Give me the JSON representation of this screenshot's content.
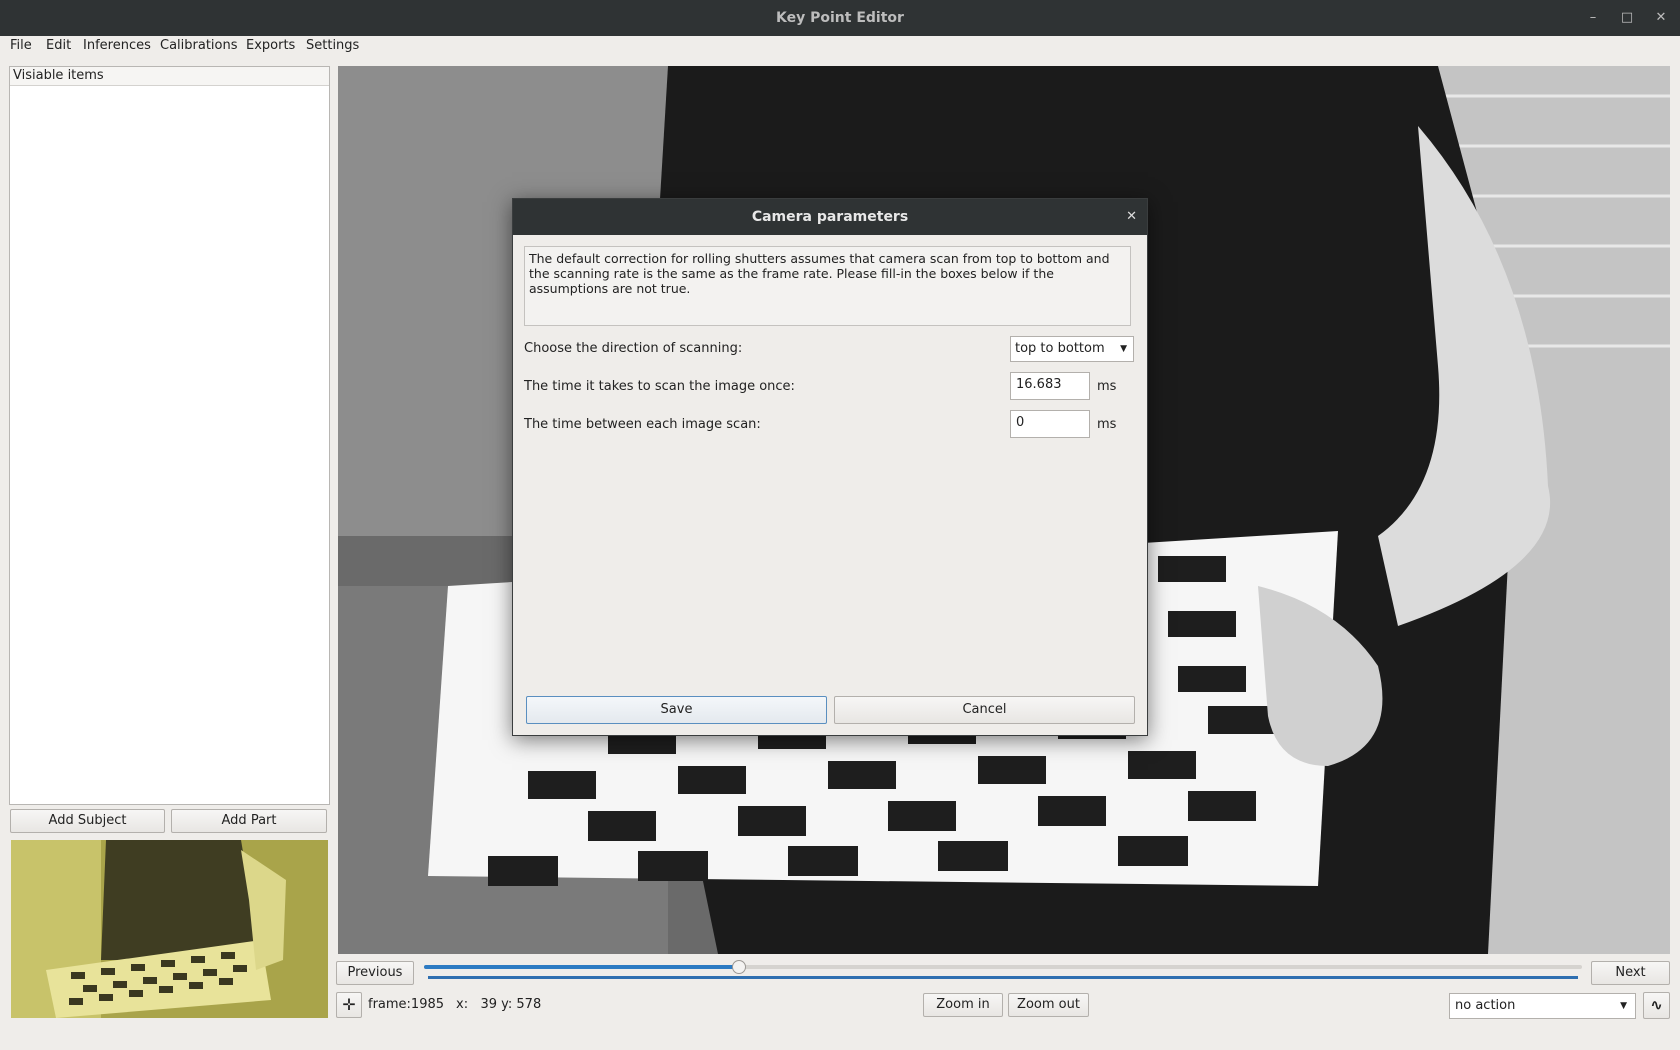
{
  "window": {
    "title": "Key Point Editor"
  },
  "menu": [
    "File",
    "Edit",
    "Inferences",
    "Calibrations",
    "Exports",
    "Settings"
  ],
  "left_panel": {
    "header": "Visiable items",
    "add_subject": "Add Subject",
    "add_part": "Add Part"
  },
  "nav": {
    "previous": "Previous",
    "next": "Next",
    "progress_fraction": 0.27
  },
  "status": {
    "frame_text": "frame:1985",
    "coords_text": "x:   39 y: 578",
    "zoom_in": "Zoom in",
    "zoom_out": "Zoom out",
    "action_select": "no action"
  },
  "dialog": {
    "title": "Camera parameters",
    "info": "The default correction for rolling shutters assumes that camera scan from top to bottom and the scanning rate is the same as the frame rate. Please fill-in the boxes below if the assumptions are not true.",
    "direction_label": "Choose the direction of scanning:",
    "direction_value": "top to bottom",
    "scan_time_label": "The time it takes to scan the image once:",
    "scan_time_value": "16.683",
    "between_label": "The time between each image scan:",
    "between_value": "0",
    "unit": "ms",
    "save": "Save",
    "cancel": "Cancel"
  }
}
